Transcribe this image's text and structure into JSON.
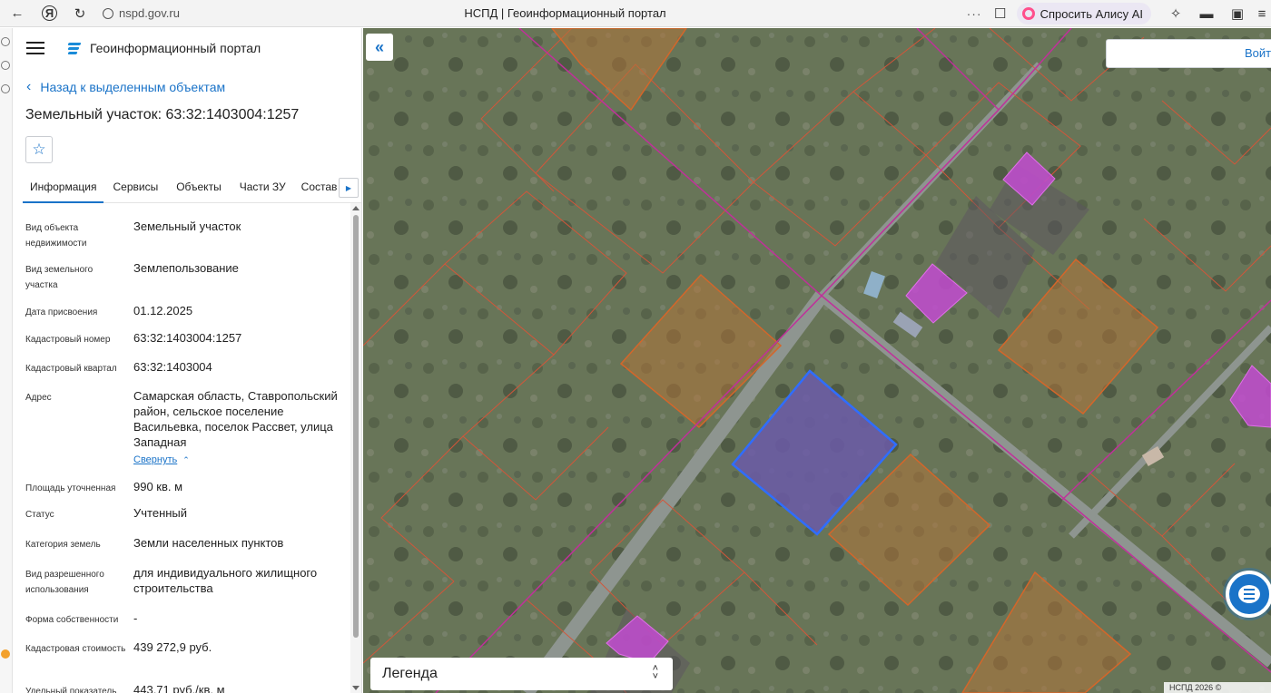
{
  "browser": {
    "url": "nspd.gov.ru",
    "tab_title": "НСПД | Геоинформационный портал",
    "dots": "···",
    "alice_label": "Спросить Алису AI"
  },
  "header": {
    "app_title": "Геоинформационный портал"
  },
  "panel": {
    "back_label": "Назад к выделенным объектам",
    "object_title": "Земельный участок: 63:32:1403004:1257",
    "tabs": [
      "Информация",
      "Сервисы",
      "Объекты",
      "Части ЗУ",
      "Состав"
    ],
    "fields": [
      {
        "key": "Вид объекта недвижимости",
        "value": "Земельный участок"
      },
      {
        "key": "Вид земельного участка",
        "value": "Землепользование"
      },
      {
        "key": "Дата присвоения",
        "value": "01.12.2025"
      },
      {
        "key": "Кадастровый номер",
        "value": "63:32:1403004:1257"
      },
      {
        "key": "Кадастровый квартал",
        "value": "63:32:1403004"
      },
      {
        "key": "Адрес",
        "value": "Самарская область, Ставропольский район, сельское поселение Васильевка, поселок Рассвет, улица Западная"
      },
      {
        "key": "Площадь уточненная",
        "value": "990 кв. м"
      },
      {
        "key": "Статус",
        "value": "Учтенный"
      },
      {
        "key": "Категория земель",
        "value": "Земли населенных пунктов"
      },
      {
        "key": "Вид разрешенного использования",
        "value": "для индивидуального жилищного строительства"
      },
      {
        "key": "Форма собственности",
        "value": "-"
      },
      {
        "key": "Кадастровая стоимость",
        "value": "439 272,9 руб."
      },
      {
        "key": "Удельный показатель",
        "value": "443,71 руб./кв. м"
      }
    ],
    "collapse_label": "Свернуть"
  },
  "map": {
    "login_label": "Войти",
    "legend_label": "Легенда",
    "copyright": "НСПД 2026 ©",
    "colors": {
      "selected_fill": "#6b5aa8",
      "selected_stroke": "#2f6dff",
      "parcel_fill": "#b0743a",
      "building_fill": "#c24bd0",
      "boundary_magenta": "#c0309a"
    }
  },
  "icons": {
    "back": "arrow-left-icon",
    "yandex": "yandex-icon",
    "reload": "reload-icon",
    "bookmark": "bookmark-icon",
    "star": "star-icon",
    "chat": "chat-icon"
  }
}
